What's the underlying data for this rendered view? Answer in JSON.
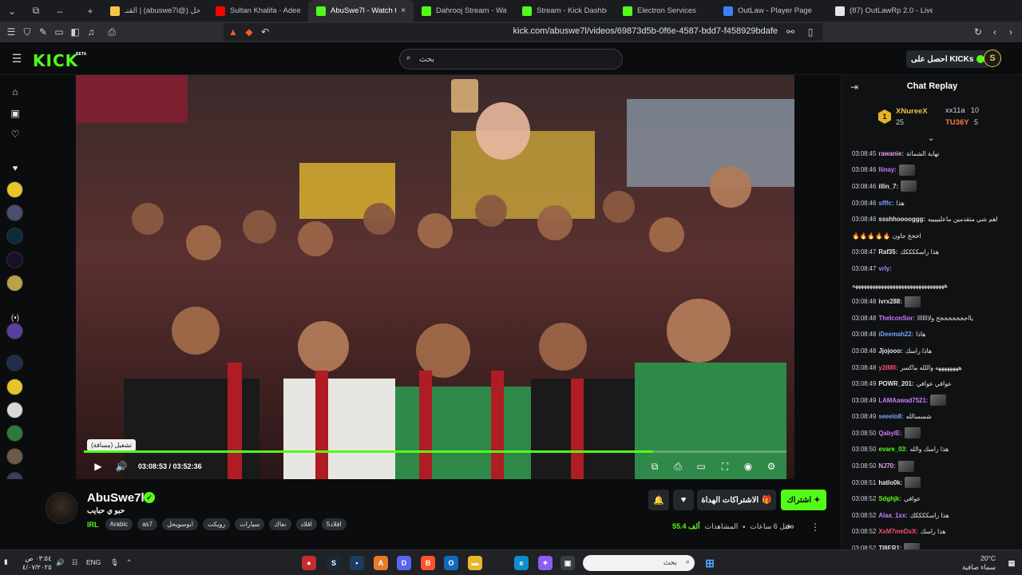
{
  "browser": {
    "tabs": [
      {
        "label": "القنـ | (abuswe7l@) ابو سويحل",
        "color": "#f2c744"
      },
      {
        "label": "Sultan Khalifa - Adeel El Rooh |",
        "color": "#ff0000"
      },
      {
        "label": "AbuSwe7l - Watch the VOD",
        "color": "#53fc18",
        "active": true
      },
      {
        "label": "Dahrooj Stream - Watch Live o",
        "color": "#53fc18"
      },
      {
        "label": "Stream - Kick Dashboard",
        "color": "#53fc18"
      },
      {
        "label": "Electron Services",
        "color": "#53fc18"
      },
      {
        "label": "OutLaw - Player Page",
        "color": "#3b82f6"
      },
      {
        "label": "(87) OutLawRp 2.0 - Live Conso",
        "color": "#e6e6e6"
      }
    ],
    "url": "kick.com/abuswe7l/videos/69873d5b-0f6e-4587-bdd7-f458929bdafe"
  },
  "header": {
    "logo": "KICK",
    "beta": "BETA",
    "search_placeholder": "بحث",
    "get_kicks": "احصل على KICKs"
  },
  "player": {
    "tooltip": "تشغيل (مسافة)",
    "current_time": "03:08:53",
    "duration": "03:52:36",
    "progress": 0.81
  },
  "channel": {
    "name": "AbuSwe7l",
    "title": "حبو ي حبايب",
    "category": "IRL",
    "tags": [
      "Arabic",
      "as7",
      "ابوسويحل",
      "رويكت",
      "سيارات",
      "نعاك",
      "اقلاد",
      "5اقلاد"
    ],
    "subscribe": "اشتراك",
    "gift": "الاشتراكات الهداة",
    "views_value": "55.4 ألف",
    "views_label": "المشاهدات",
    "ago": "قبل 6 ساعات"
  },
  "chat": {
    "title": "Chat Replay",
    "leaders": [
      {
        "rank": "1",
        "name": "XNureeX",
        "count": "25"
      },
      {
        "name": "xx11a",
        "count": "10"
      },
      {
        "name": "TU36Y",
        "count": "5"
      }
    ],
    "messages": [
      {
        "t": "03:08:45",
        "u": "rawanie:",
        "c": "#e8a0e8",
        "m": "نهاية الشماتة"
      },
      {
        "t": "03:08:46",
        "u": "llinay:",
        "c": "#c77dff",
        "m": "",
        "e": true
      },
      {
        "t": "03:08:46",
        "u": "illin_7:",
        "c": "#e6e6e6",
        "m": "",
        "e": true
      },
      {
        "t": "03:08:46",
        "u": "sfffc:",
        "c": "#7aa2ff",
        "m": "هذا"
      },
      {
        "t": "03:08:46",
        "u": "ssshhooooggg:",
        "c": "#e6e6e6",
        "m": "اهم شي متقدمين ماعليييييه"
      },
      {
        "t": "",
        "u": "",
        "c": "#e6e6e6",
        "m": "🔥🔥🔥🔥🔥 اخخخ جاون"
      },
      {
        "t": "03:08:47",
        "u": "Raf35:",
        "c": "#e6e6e6",
        "m": "هذا راسككككك"
      },
      {
        "t": "03:08:47",
        "u": "vrly:",
        "c": "#a78bfa",
        "m": ""
      },
      {
        "t": "",
        "u": "",
        "c": "#e6e6e6",
        "m": "ههههههههههههههههههههههههههههههههه"
      },
      {
        "t": "03:08:48",
        "u": "ivrx288:",
        "c": "#e6e6e6",
        "m": "",
        "e": true
      },
      {
        "t": "03:08:48",
        "u": "TheIconSor:",
        "c": "#c77dff",
        "m": "يااخخخخخخخخ ولااااااا"
      },
      {
        "t": "03:08:48",
        "u": "iDeemah22:",
        "c": "#7aa2ff",
        "m": "هاذا"
      },
      {
        "t": "03:08:48",
        "u": "Jjojooo:",
        "c": "#e6e6e6",
        "m": "هاذا راسك"
      },
      {
        "t": "03:08:48",
        "u": "y2lMll:",
        "c": "#ff4d6d",
        "m": "ههههههههه واللله ماكسر"
      },
      {
        "t": "03:08:49",
        "u": "POWR_201:",
        "c": "#e6e6e6",
        "m": "عوافي عوافي"
      },
      {
        "t": "03:08:49",
        "u": "LAMAawad7521:",
        "c": "#c77dff",
        "m": "",
        "e": true
      },
      {
        "t": "03:08:49",
        "u": "seeelo8:",
        "c": "#7aa2ff",
        "m": "شسسالله"
      },
      {
        "t": "03:08:50",
        "u": "QabylE:",
        "c": "#c77dff",
        "m": "",
        "e": true
      },
      {
        "t": "03:08:50",
        "u": "evare_03:",
        "c": "#53fc18",
        "m": "هذا راسك والله"
      },
      {
        "t": "03:08:50",
        "u": "NJ70:",
        "c": "#e8a0e8",
        "m": "",
        "e": true
      },
      {
        "t": "03:08:51",
        "u": "hatlo0k:",
        "c": "#e6e6e6",
        "m": "",
        "e": true
      },
      {
        "t": "03:08:52",
        "u": "Sdghjk:",
        "c": "#53fc18",
        "m": "عوافي"
      },
      {
        "t": "03:08:52",
        "u": "Alaa_1xx:",
        "c": "#c77dff",
        "m": "هذا راسككككك"
      },
      {
        "t": "03:08:52",
        "u": "XxM7meDxX:",
        "c": "#ff4d6d",
        "m": "هذا راسك"
      },
      {
        "t": "03:08:52",
        "u": "TI8ER1:",
        "c": "#e6e6e6",
        "m": "",
        "e": true
      }
    ]
  },
  "taskbar": {
    "search": "بحث",
    "lang": "ENG",
    "weather_temp": "20°C",
    "weather_desc": "سماء صافية",
    "time": "٠٣:٥٤ ص",
    "date": "٤/٠٧/٢٠٢٥"
  }
}
